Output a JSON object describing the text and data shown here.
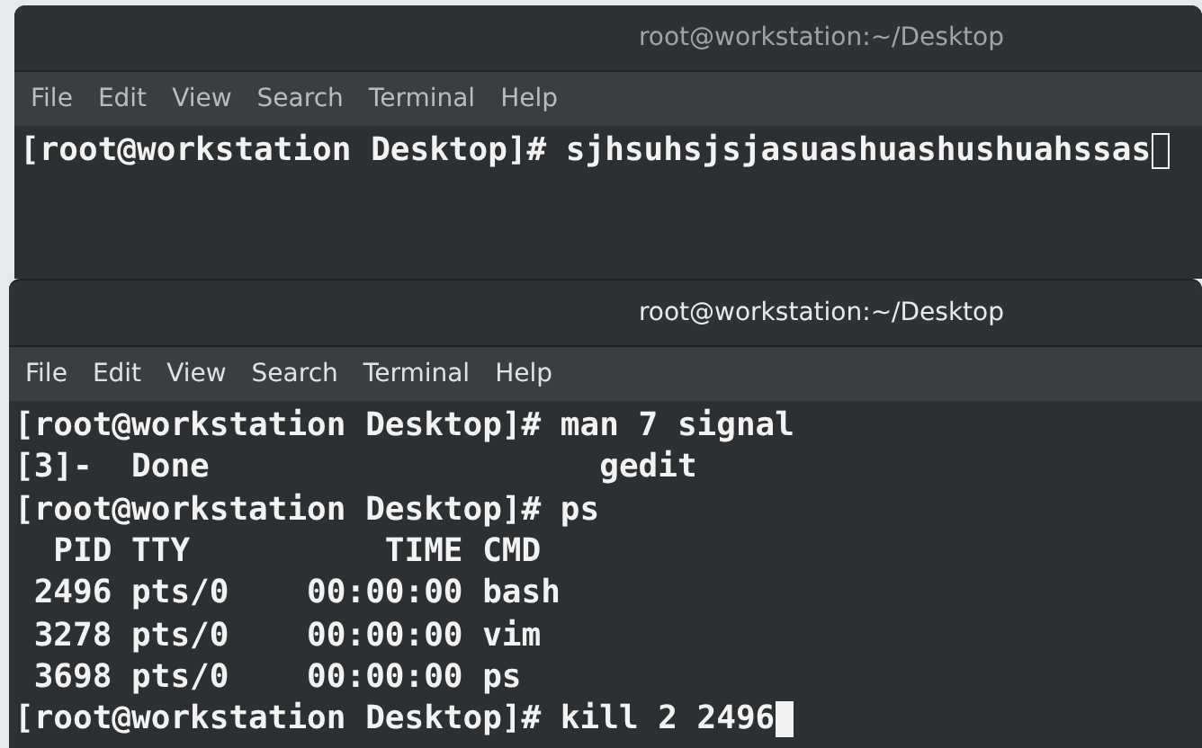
{
  "windows": [
    {
      "title": "root@workstation:~/Desktop",
      "focused": false,
      "menu": [
        "File",
        "Edit",
        "View",
        "Search",
        "Terminal",
        "Help"
      ],
      "lines": [
        "[root@workstation Desktop]# sjhsuhsjsjasuashuashushuahssas"
      ]
    },
    {
      "title": "root@workstation:~/Desktop",
      "focused": true,
      "menu": [
        "File",
        "Edit",
        "View",
        "Search",
        "Terminal",
        "Help"
      ],
      "lines": [
        "[root@workstation Desktop]# man 7 signal",
        "[3]-  Done                    gedit",
        "[root@workstation Desktop]# ps",
        "  PID TTY          TIME CMD",
        " 2496 pts/0    00:00:00 bash",
        " 3278 pts/0    00:00:00 vim",
        " 3698 pts/0    00:00:00 ps",
        "[root@workstation Desktop]# kill 2 2496"
      ]
    }
  ]
}
